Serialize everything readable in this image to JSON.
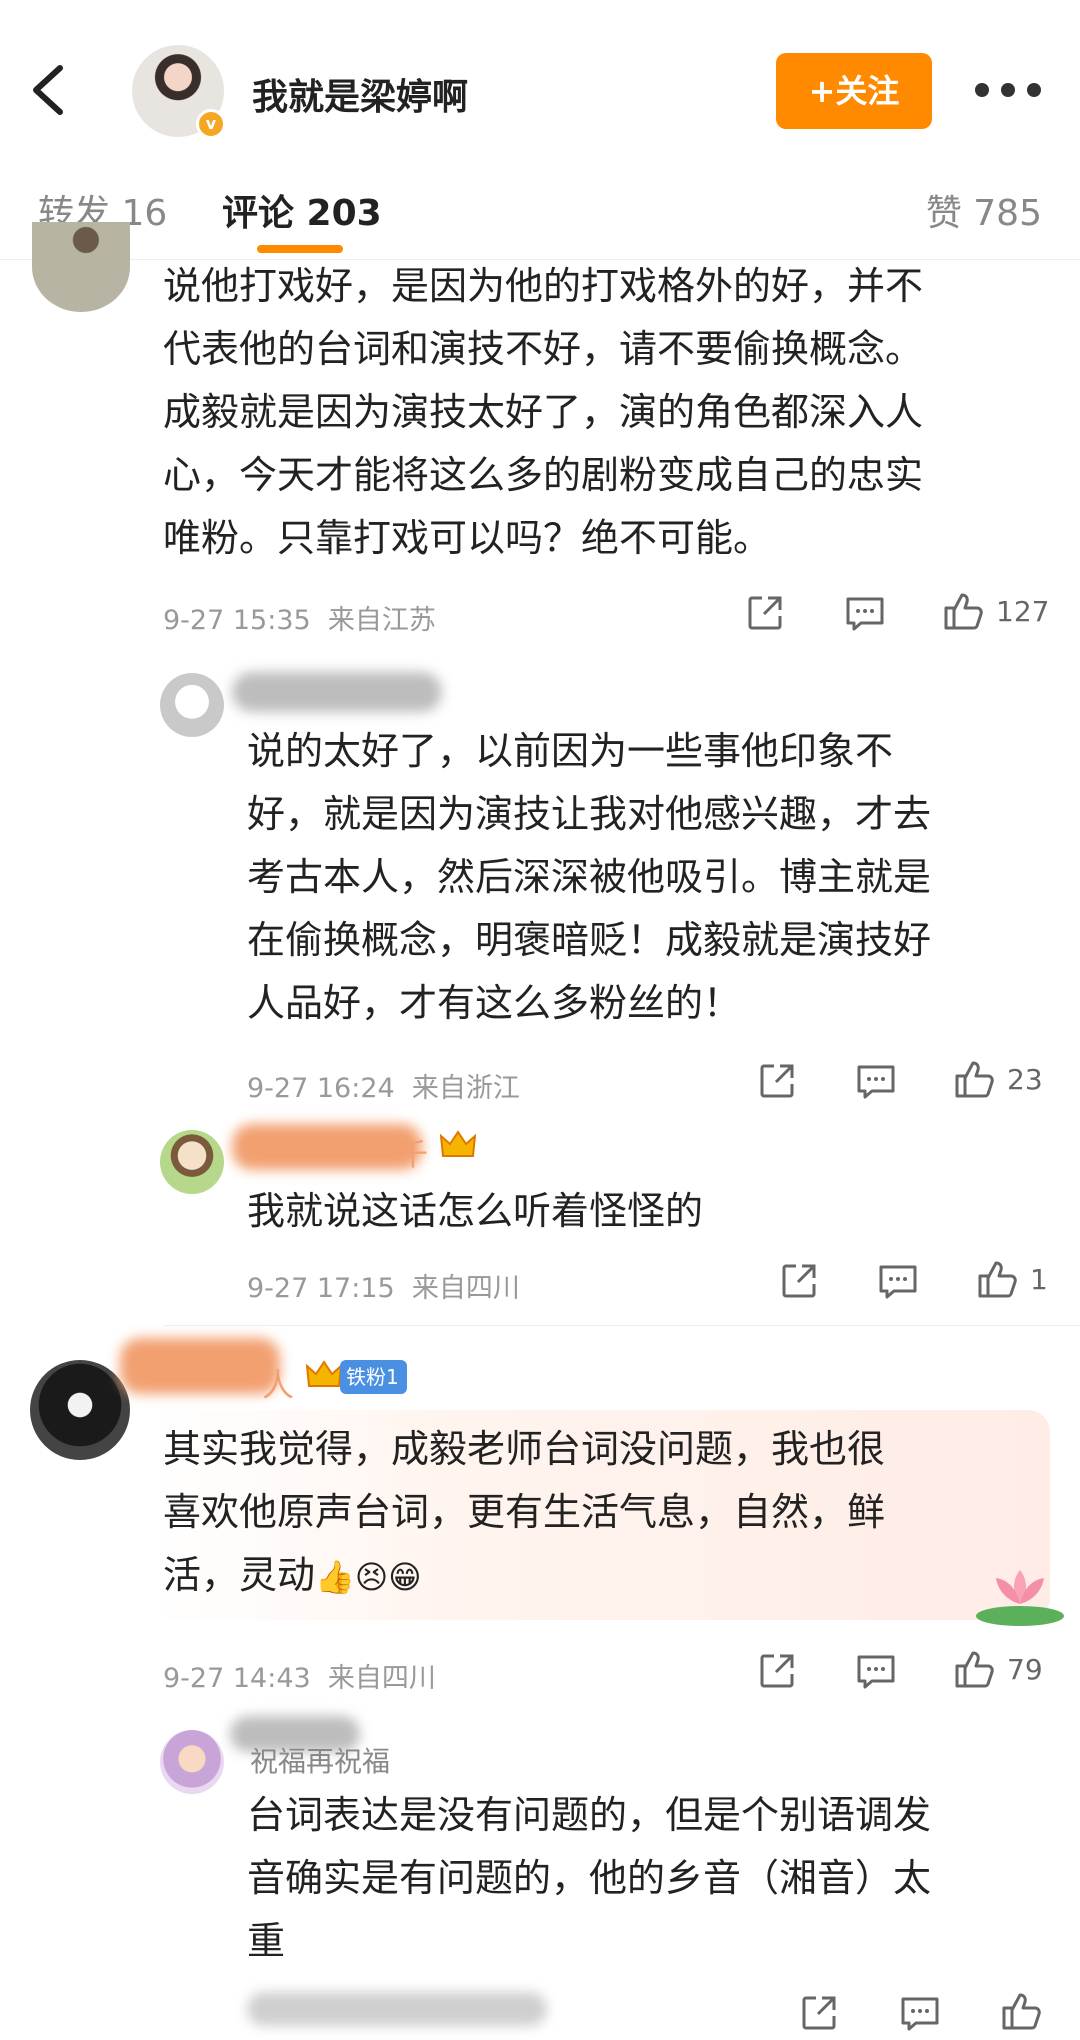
{
  "header": {
    "username": "我就是梁婷啊",
    "follow_label": "+关注",
    "verified_mark": "v"
  },
  "tabs": {
    "repost": "转发 16",
    "comment": "评论 203",
    "like": "赞 785"
  },
  "comments": [
    {
      "text": "说他打戏好，是因为他的打戏格外的好，并不代表他的台词和演技不好，请不要偷换概念。成毅就是因为演技太好了，演的角色都深入人心，今天才能将这么多的剧粉变成自己的忠实唯粉。只靠打戏可以吗？绝不可能。",
      "lines": [
        "说他打戏好，是因为他的打戏格外的好，并不",
        "代表他的台词和演技不好，请不要偷换概念。",
        "成毅就是因为演技太好了，演的角色都深入人",
        "心，今天才能将这么多的剧粉变成自己的忠实",
        "唯粉。只靠打戏可以吗？绝不可能。"
      ],
      "time": "9-27 15:35",
      "location": "来自江苏",
      "likes": "127"
    },
    {
      "lines": [
        "说的太好了，以前因为一些事他印象不",
        "好，就是因为演技让我对他感兴趣，才去",
        "考古本人，然后深深被他吸引。博主就是",
        "在偷换概念，明褒暗贬！成毅就是演技好",
        "人品好，才有这么多粉丝的！"
      ],
      "time": "9-27 16:24",
      "location": "来自浙江",
      "likes": "23"
    },
    {
      "lines": [
        "我就说这话怎么听着怪怪的"
      ],
      "name_fragment": "千",
      "time": "9-27 17:15",
      "location": "来自四川",
      "likes": "1"
    },
    {
      "lines": [
        "其实我觉得，成毅老师台词没问题，我也很",
        "喜欢他原声台词，更有生活气息，自然，鲜"
      ],
      "last_line_text": "活，灵动",
      "emojis": [
        "👍",
        "😣",
        "😁"
      ],
      "name_fragment": "人",
      "fan_badge": "铁粉1",
      "time": "9-27 14:43",
      "location": "来自四川",
      "likes": "79"
    },
    {
      "lines": [
        "台词表达是没有问题的，但是个别语调发",
        "音确实是有问题的，他的乡音（湘音）太",
        "重"
      ],
      "name_fragment": "祝福再祝福"
    }
  ],
  "colors": {
    "accent_orange": "#ff8a00",
    "fan_badge_blue": "#4a90e2"
  },
  "icons": [
    "back-arrow-icon",
    "more-dots-icon",
    "share-icon",
    "comment-icon",
    "like-icon",
    "crown-icon",
    "lotus-icon"
  ]
}
